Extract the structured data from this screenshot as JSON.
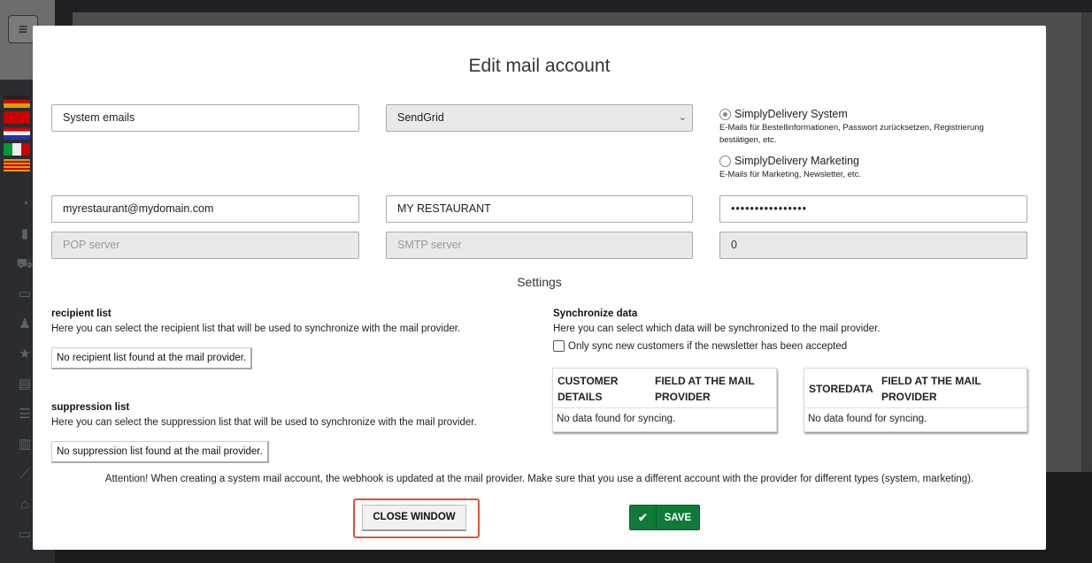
{
  "colors": {
    "accent_green": "#0f7a39",
    "highlight_red": "#e0533a",
    "overlay": "#1f2124"
  },
  "background": {
    "menu_icon": "hamburger-icon",
    "sidebar_icons": [
      "gauge-icon",
      "bar-chart-icon",
      "cart-icon",
      "monitor-icon",
      "user-plus-icon",
      "star-icon",
      "archive-icon",
      "list-icon",
      "book-icon",
      "line-chart-icon",
      "home-icon",
      "monitor-icon"
    ]
  },
  "modal": {
    "title": "Edit mail account",
    "fields": {
      "name": "System emails",
      "provider": "SendGrid",
      "email": "myrestaurant@mydomain.com",
      "sender_name": "MY RESTAURANT",
      "password": "••••••••••••••••",
      "pop_server_placeholder": "POP server",
      "smtp_server_placeholder": "SMTP server",
      "port": "0"
    },
    "account_type": {
      "option1_label": "SimplyDelivery System",
      "option1_desc": "E-Mails für Bestellinformationen, Passwort zurücksetzen, Registrierung bestätigen, etc.",
      "option2_label": "SimplyDelivery Marketing",
      "option2_desc": "E-Mails für Marketing, Newsletter, etc."
    },
    "settings_title": "Settings",
    "recipient": {
      "title": "recipient list",
      "text": "Here you can select the recipient list that will be used to synchronize with the mail provider.",
      "button": "No recipient list found at the mail provider."
    },
    "suppression": {
      "title": "suppression list",
      "text": "Here you can select the suppression list that will be used to synchronize with the mail provider.",
      "button": "No suppression list found at the mail provider."
    },
    "sync": {
      "title": "Synchronize data",
      "text": "Here you can select which data will be synchronized to the mail provider.",
      "checkbox_label": "Only sync new customers if the newsletter has been accepted",
      "table1": {
        "col1": "CUSTOMER DETAILS",
        "col2": "FIELD AT THE MAIL PROVIDER",
        "empty": "No data found for syncing."
      },
      "table2": {
        "col1": "STOREDATA",
        "col2": "FIELD AT THE MAIL PROVIDER",
        "empty": "No data found for syncing."
      }
    },
    "attention": "Attention! When creating a system mail account, the webhook is updated at the mail provider. Make sure that you use a different account with the provider for different types (system, marketing).",
    "close_label": "CLOSE WINDOW",
    "save_label": "SAVE"
  }
}
